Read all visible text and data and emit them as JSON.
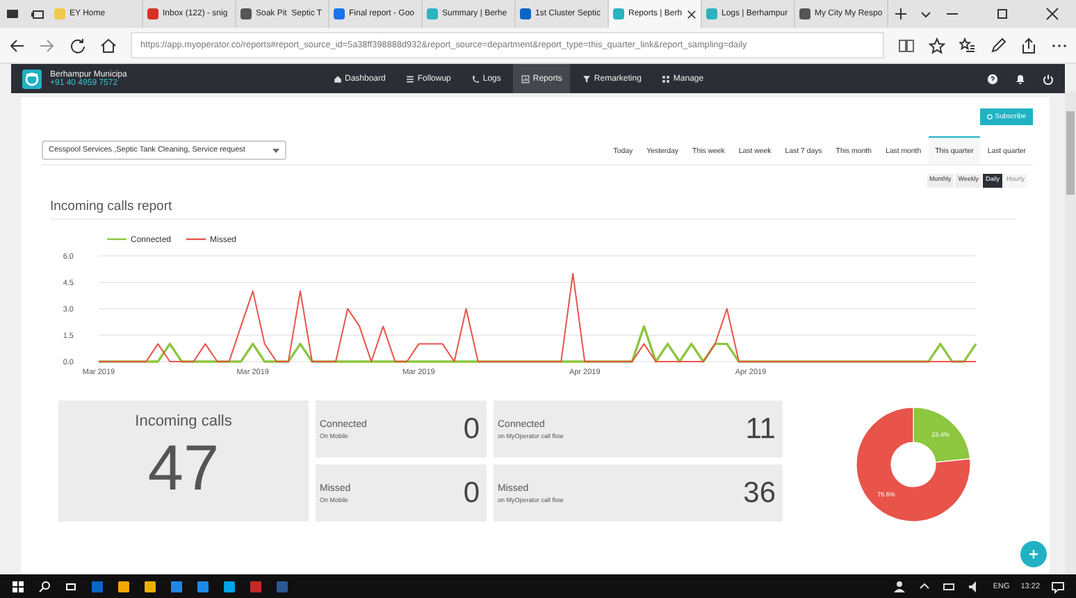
{
  "browser": {
    "tabs": [
      {
        "label": "EY Home",
        "selected": false
      },
      {
        "label": "Inbox (122) - snig",
        "selected": false
      },
      {
        "label": "Soak Pit  Septic T",
        "selected": false
      },
      {
        "label": "Final report - Goo",
        "selected": false
      },
      {
        "label": "Summary | Berhe",
        "selected": false
      },
      {
        "label": "1st Cluster Septic",
        "selected": false
      },
      {
        "label": "Reports | Berh",
        "selected": true
      },
      {
        "label": "Logs | Berhampur",
        "selected": false
      },
      {
        "label": "My City My Respo",
        "selected": false
      }
    ],
    "address": "https://app.myoperator.co/reports#report_source_id=5a38ff398888d932&report_source=department&report_type=this_quarter_link&report_sampling=daily"
  },
  "app": {
    "org_name": "Berhampur Municipa",
    "phone": "+91 40 4959 7572",
    "nav": [
      {
        "label": "Dashboard",
        "selected": false
      },
      {
        "label": "Followup",
        "selected": false
      },
      {
        "label": "Logs",
        "selected": false
      },
      {
        "label": "Reports",
        "selected": true
      },
      {
        "label": "Remarketing",
        "selected": false
      },
      {
        "label": "Manage",
        "selected": false
      }
    ]
  },
  "report": {
    "subscribe": "Subscribe",
    "filter": "Cesspool Services ,Septic Tank Cleaning, Service request",
    "ranges": [
      {
        "label": "Today",
        "selected": false
      },
      {
        "label": "Yesterday",
        "selected": false
      },
      {
        "label": "This week",
        "selected": false
      },
      {
        "label": "Last week",
        "selected": false
      },
      {
        "label": "Last 7 days",
        "selected": false
      },
      {
        "label": "This month",
        "selected": false
      },
      {
        "label": "Last month",
        "selected": false
      },
      {
        "label": "This quarter",
        "selected": true
      },
      {
        "label": "Last quarter",
        "selected": false
      }
    ],
    "sampling": [
      {
        "label": "Monthly",
        "selected": false,
        "disabled": false
      },
      {
        "label": "Weekly",
        "selected": false,
        "disabled": false
      },
      {
        "label": "Daily",
        "selected": true,
        "disabled": false
      },
      {
        "label": "Hourly",
        "selected": false,
        "disabled": true
      }
    ],
    "title": "Incoming calls report",
    "chart_data": {
      "type": "line",
      "categories": [
        "Mar 2019",
        null,
        null,
        null,
        null,
        null,
        null,
        null,
        null,
        null,
        null,
        null,
        null,
        "Mar 2019",
        null,
        null,
        null,
        null,
        null,
        null,
        null,
        null,
        null,
        null,
        null,
        null,
        null,
        "Mar 2019",
        null,
        null,
        null,
        null,
        null,
        null,
        null,
        null,
        null,
        null,
        null,
        null,
        null,
        "Apr 2019",
        null,
        null,
        null,
        null,
        null,
        null,
        null,
        null,
        null,
        null,
        null,
        null,
        null,
        "Apr 2019",
        null,
        null,
        null,
        null,
        null,
        null,
        null,
        null,
        null,
        null,
        null,
        null,
        null,
        null,
        null,
        null,
        null,
        null,
        null
      ],
      "series": [
        {
          "name": "Connected",
          "color": "#8dc63f",
          "values": [
            0,
            0,
            0,
            0,
            0,
            0,
            1,
            0,
            0,
            0,
            0,
            0,
            0,
            1,
            0,
            0,
            0,
            1,
            0,
            0,
            0,
            0,
            0,
            0,
            0,
            0,
            0,
            0,
            0,
            0,
            0,
            0,
            0,
            0,
            0,
            0,
            0,
            0,
            0,
            0,
            0,
            0,
            0,
            0,
            0,
            0,
            2,
            0,
            1,
            0,
            1,
            0,
            1,
            1,
            0,
            0,
            0,
            0,
            0,
            0,
            0,
            0,
            0,
            0,
            0,
            0,
            0,
            0,
            0,
            0,
            0,
            1,
            0,
            0,
            1
          ]
        },
        {
          "name": "Missed",
          "color": "#e8534a",
          "values": [
            0,
            0,
            0,
            0,
            0,
            1,
            0,
            0,
            0,
            1,
            0,
            0,
            2,
            4,
            1,
            0,
            0,
            4,
            0,
            0,
            0,
            3,
            2,
            0,
            2,
            0,
            0,
            1,
            1,
            1,
            0,
            3,
            0,
            0,
            0,
            0,
            0,
            0,
            0,
            0,
            5,
            0,
            0,
            0,
            0,
            0,
            1,
            0,
            0,
            0,
            0,
            0,
            1,
            3,
            0,
            0,
            0,
            0,
            0,
            0,
            0,
            0,
            0,
            0,
            0,
            0,
            0,
            0,
            0,
            0,
            0,
            0,
            0,
            0,
            0
          ]
        }
      ],
      "ylim": [
        0,
        6
      ],
      "grid": true,
      "legend": true,
      "yticks": [
        {
          "value": 0,
          "label": "0.0"
        },
        {
          "value": 1.5,
          "label": "1.5"
        },
        {
          "value": 3,
          "label": "3.0"
        },
        {
          "value": 4.5,
          "label": "4.5"
        },
        {
          "value": 6,
          "label": "6.0"
        }
      ]
    }
  },
  "stats": {
    "total": {
      "label": "Incoming calls",
      "value": "47"
    },
    "tiles": [
      {
        "label": "Connected",
        "sub": "On Mobile",
        "value": "0"
      },
      {
        "label": "Connected",
        "sub": "on MyOperator call flow",
        "value": "11"
      },
      {
        "label": "Missed",
        "sub": "On Mobile",
        "value": "0"
      },
      {
        "label": "Missed",
        "sub": "on MyOperator call flow",
        "value": "36"
      }
    ],
    "donut": {
      "chart_data": {
        "type": "donut",
        "values": [
          23.4,
          76.6
        ],
        "value_labels": [
          "23.4%",
          "76.6%"
        ],
        "colors": [
          "#8dc63f",
          "#e8534a"
        ]
      }
    }
  },
  "taskbar": {
    "language": "ENG",
    "time": "13:22"
  }
}
